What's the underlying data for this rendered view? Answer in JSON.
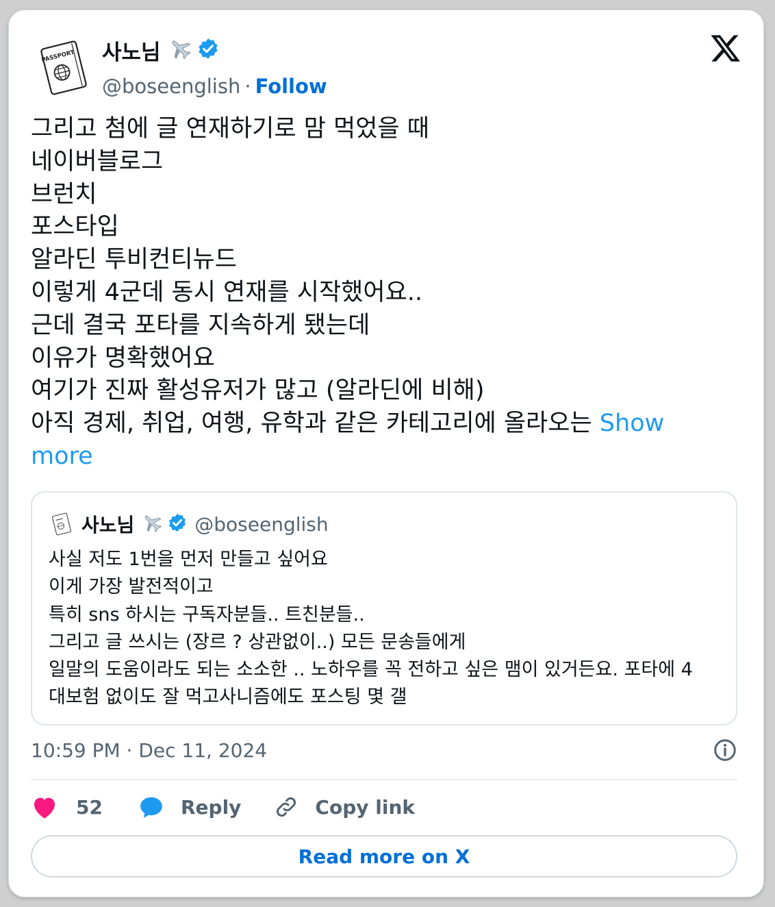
{
  "author": {
    "name": "사노님",
    "emoji": "✈️",
    "handle": "@boseenglish",
    "follow_label": "Follow",
    "avatar_text": "PASSPORT",
    "verified_color": "#1d9bf0"
  },
  "tweet": {
    "lines": [
      "그리고 첨에 글 연재하기로 맘 먹었을 때",
      "네이버블로그",
      "브런치",
      "포스타입",
      "알라딘 투비컨티뉴드",
      "이렇게 4군데 동시 연재를 시작했어요..",
      "근데 결국 포타를 지속하게 됐는데",
      "이유가 명확했어요",
      "여기가 진짜 활성유저가 많고 (알라딘에 비해)",
      "아직 경제, 취업, 여행, 유학과 같은 카테고리에 올라오는 "
    ],
    "show_more_label": "Show more"
  },
  "quoted_tweet": {
    "name": "사노님",
    "emoji": "✈️",
    "handle": "@boseenglish",
    "lines": [
      "사실 저도 1번을 먼저 만들고 싶어요",
      "이게 가장 발전적이고",
      "특히 sns 하시는 구독자분들.. 트친분들..",
      "그리고 글 쓰시는 (장르 ? 상관없이..) 모든 문송들에게",
      "일말의 도움이라도 되는 소소한 .. 노하우를 꼭 전하고 싶은 맴이 있거든요. 포타에 4",
      "대보험 없이도 잘 먹고사니즘에도 포스팅 몇 갤"
    ]
  },
  "timestamp": "10:59 PM · Dec 11, 2024",
  "actions": {
    "like_count": "52",
    "reply_label": "Reply",
    "copy_label": "Copy link"
  },
  "read_more_label": "Read more on X",
  "colors": {
    "accent": "#006fd6",
    "show_more": "#1d9bf0",
    "like": "#f91880",
    "muted": "#536471"
  },
  "icons": {
    "logo": "x-logo-icon",
    "verified": "verified-badge-icon",
    "airplane": "airplane-emoji-icon",
    "info": "info-icon",
    "like": "heart-icon",
    "reply": "speech-bubble-icon",
    "copy": "link-icon"
  }
}
